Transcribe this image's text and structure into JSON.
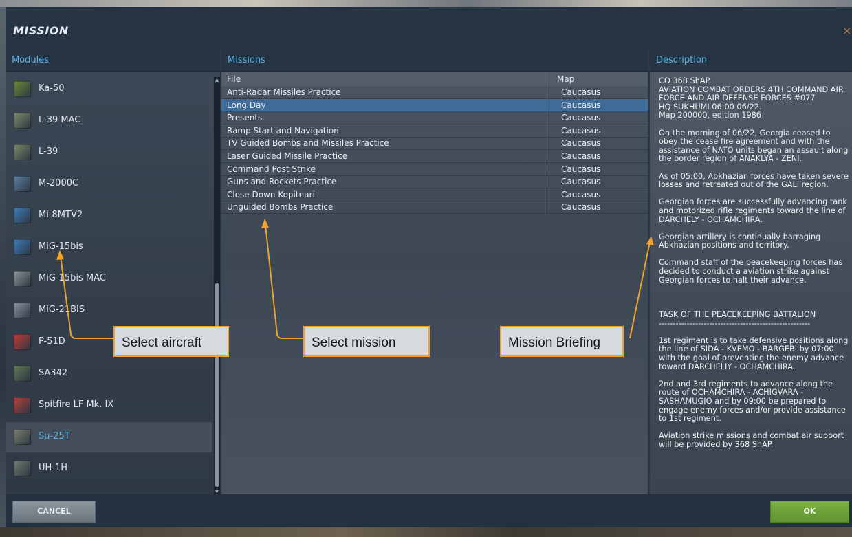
{
  "window": {
    "title": "MISSION",
    "close_glyph": "×"
  },
  "modules": {
    "header": "Modules",
    "items": [
      {
        "label": "Ka-50",
        "icon": "ka-50-icon",
        "color": "#6d8a3a",
        "selected": false
      },
      {
        "label": "L-39 MAC",
        "icon": "l-39-mac-icon",
        "color": "#7d8a6a",
        "selected": false
      },
      {
        "label": "L-39",
        "icon": "l-39-icon",
        "color": "#7d8a6a",
        "selected": false
      },
      {
        "label": "M-2000C",
        "icon": "m-2000c-icon",
        "color": "#5d7fa3",
        "selected": false
      },
      {
        "label": "Mi-8MTV2",
        "icon": "mi-8mtv2-icon",
        "color": "#3f7cb6",
        "selected": false
      },
      {
        "label": "MiG-15bis",
        "icon": "mig-15bis-icon",
        "color": "#3b7fc0",
        "selected": false
      },
      {
        "label": "MiG-15bis MAC",
        "icon": "mig-15bis-mac-icon",
        "color": "#8f959b",
        "selected": false
      },
      {
        "label": "MiG-21BIS",
        "icon": "mig-21bis-icon",
        "color": "#8a93a3",
        "selected": false
      },
      {
        "label": "P-51D",
        "icon": "p-51d-icon",
        "color": "#c23a3a",
        "selected": false
      },
      {
        "label": "SA342",
        "icon": "sa342-icon",
        "color": "#5f7a5a",
        "selected": false
      },
      {
        "label": "Spitfire LF Mk. IX",
        "icon": "spitfire-icon",
        "color": "#b84040",
        "selected": false
      },
      {
        "label": "Su-25T",
        "icon": "su-25t-icon",
        "color": "#7b7f70",
        "selected": true
      },
      {
        "label": "UH-1H",
        "icon": "uh-1h-icon",
        "color": "#6f7c72",
        "selected": false
      }
    ]
  },
  "missions": {
    "header": "Missions",
    "columns": {
      "file": "File",
      "map": "Map"
    },
    "rows": [
      {
        "file": "Anti-Radar Missiles Practice",
        "map": "Caucasus",
        "selected": false
      },
      {
        "file": "Long Day",
        "map": "Caucasus",
        "selected": true
      },
      {
        "file": "Presents",
        "map": "Caucasus",
        "selected": false
      },
      {
        "file": "Ramp Start and Navigation",
        "map": "Caucasus",
        "selected": false
      },
      {
        "file": "TV Guided Bombs and Missiles Practice",
        "map": "Caucasus",
        "selected": false
      },
      {
        "file": "Laser Guided Missile Practice",
        "map": "Caucasus",
        "selected": false
      },
      {
        "file": "Command Post Strike",
        "map": "Caucasus",
        "selected": false
      },
      {
        "file": "Guns and Rockets Practice",
        "map": "Caucasus",
        "selected": false
      },
      {
        "file": "Close Down Kopitnari",
        "map": "Caucasus",
        "selected": false
      },
      {
        "file": "Unguided Bombs Practice",
        "map": "Caucasus",
        "selected": false
      }
    ]
  },
  "description": {
    "header": "Description",
    "paragraphs": [
      "CO 368 ShAP.\nAVIATION COMBAT ORDERS 4TH COMMAND AIR FORCE AND AIR DEFENSE FORCES #077\nHQ SUKHUMI 06:00  06/22.\nMap 200000, edition 1986",
      "On the morning of 06/22, Georgia ceased to obey the cease fire agreement and with the assistance of NATO units began an assault along the border region of ANAKLYA - ZENI.",
      "As of 05:00, Abkhazian forces have taken severe losses and retreated out of the GALI region.",
      "Georgian forces are successfully advancing tank and motorized rifle regiments toward the line of DARCHELY - OCHAMCHIRA.",
      "Georgian artillery is continually barraging Abkhazian positions and territory.",
      "Command staff of the peacekeeping forces has decided to conduct a aviation strike against Georgian forces to halt their advance.",
      "",
      "TASK OF THE PEACEKEEPING BATTALION\n------------------------------------------------------",
      "1st regiment is to take defensive positions along the line of SIDA - KVEMO - BARGEBI by 07:00 with the goal of preventing the enemy advance toward DARCHELIY - OCHAMCHIRA.",
      "2nd and 3rd regiments to advance along the route of OCHAMCHIRA - ACHIGVARA - SASHAMUGIO and by 09:00 be prepared to engage enemy forces and/or provide assistance to 1st regiment.",
      "Aviation strike missions and combat air support will be provided by 368 ShAP."
    ]
  },
  "footer": {
    "cancel_label": "CANCEL",
    "ok_label": "OK"
  },
  "annotations": {
    "select_aircraft": "Select aircraft",
    "select_mission": "Select mission",
    "mission_briefing": "Mission Briefing"
  },
  "colors": {
    "accent": "#58b3e6",
    "selection": "#3f6b98",
    "callout_border": "#f1a12d",
    "ok_green": "#6fa63a"
  }
}
